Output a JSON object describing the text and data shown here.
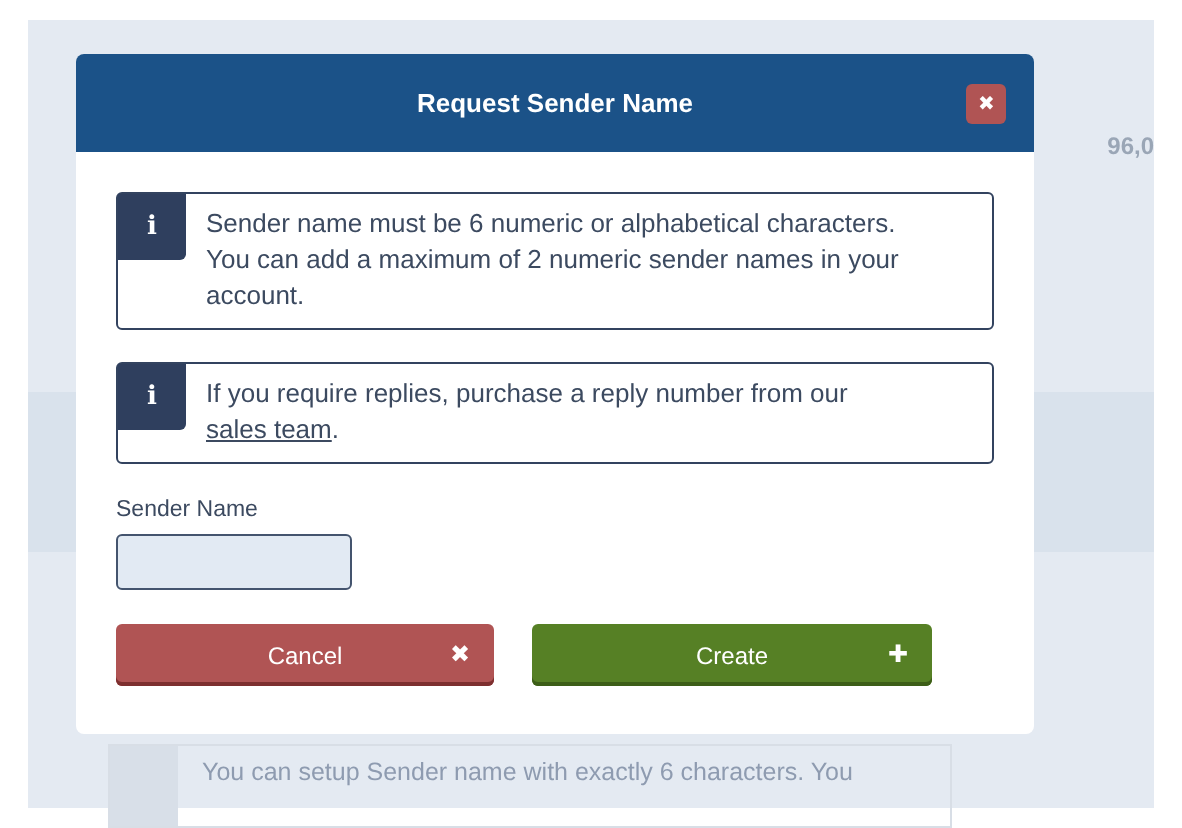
{
  "background": {
    "value": "96,0",
    "note": "You can setup Sender name with exactly 6 characters. You"
  },
  "dialog": {
    "title": "Request Sender Name",
    "close": "✖",
    "notices": [
      {
        "icon": "i",
        "parts": [
          {
            "kind": "text",
            "text": "Sender name must be 6 numeric or alphabetical characters. You can add a maximum of 2 numeric sender names in your account."
          }
        ]
      },
      {
        "icon": "i",
        "parts": [
          {
            "kind": "text",
            "text": "If you require replies, purchase a reply number from our "
          },
          {
            "kind": "link",
            "text": "sales team"
          },
          {
            "kind": "text",
            "text": "."
          }
        ]
      }
    ],
    "field": {
      "label": "Sender Name"
    },
    "buttons": [
      {
        "kind": "cancel",
        "label": "Cancel",
        "icon": "✖"
      },
      {
        "kind": "create",
        "label": "Create",
        "icon": "✚"
      }
    ]
  }
}
